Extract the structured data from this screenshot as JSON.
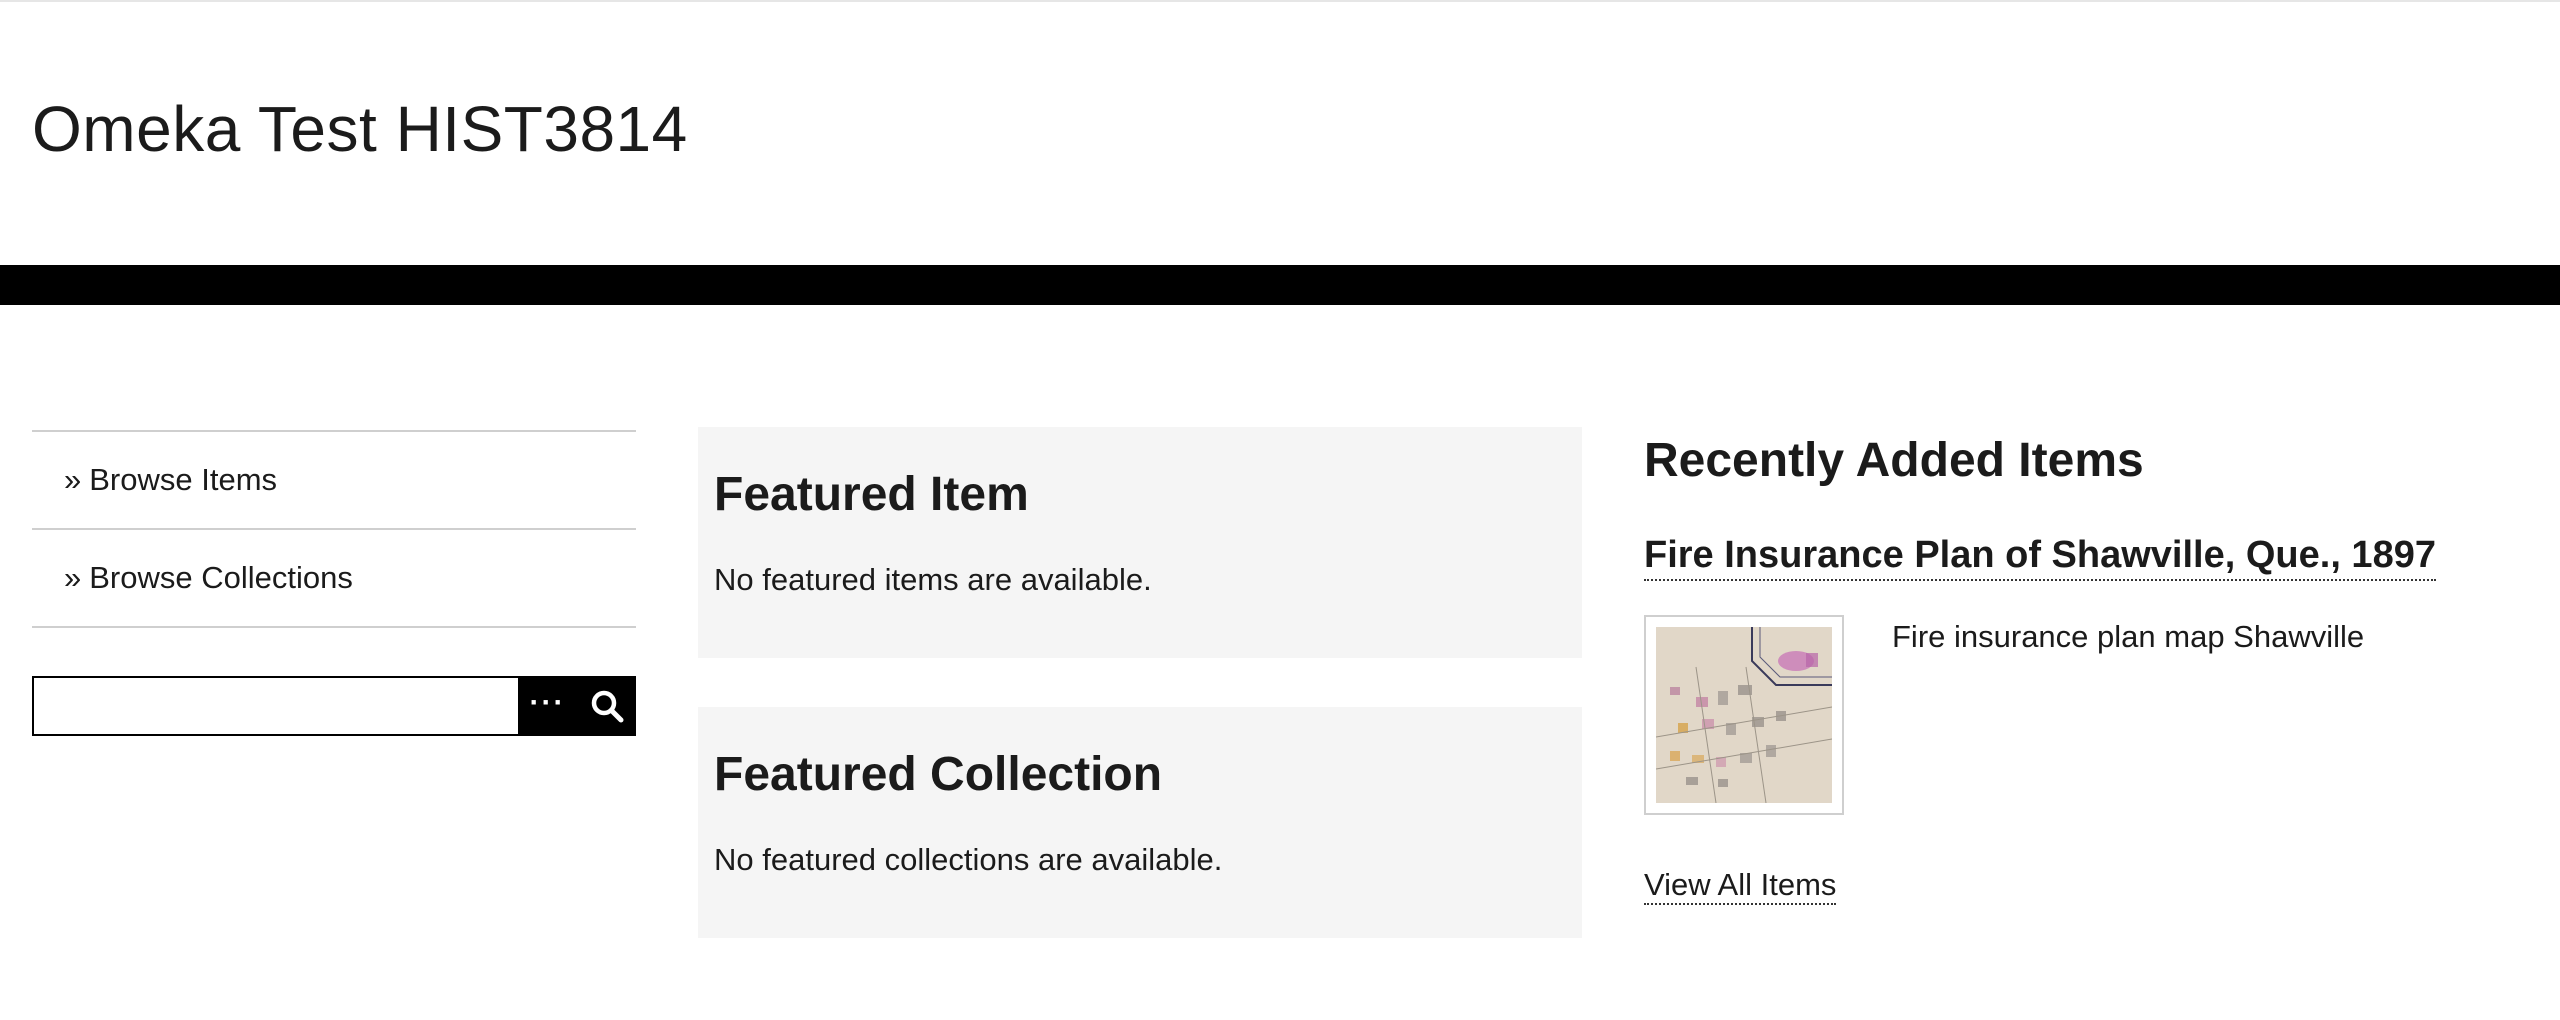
{
  "site": {
    "title": "Omeka Test HIST3814"
  },
  "sidebar": {
    "nav_items": [
      {
        "label": "Browse Items"
      },
      {
        "label": "Browse Collections"
      }
    ],
    "search": {
      "value": "",
      "advanced_label": "···",
      "icons": [
        "ellipsis-icon",
        "search-icon"
      ]
    }
  },
  "featured_item": {
    "heading": "Featured Item",
    "message": "No featured items are available."
  },
  "featured_collection": {
    "heading": "Featured Collection",
    "message": "No featured collections are available."
  },
  "recent": {
    "heading": "Recently Added Items",
    "items": [
      {
        "title": "Fire Insurance Plan of Shawville, Que., 1897",
        "description": "Fire insurance plan map Shawville"
      }
    ],
    "view_all_label": "View All Items"
  },
  "colors": {
    "header_bar": "#000000",
    "featured_bg": "#f5f5f5",
    "text": "#1b1b1b",
    "divider": "#cfcfcf"
  }
}
